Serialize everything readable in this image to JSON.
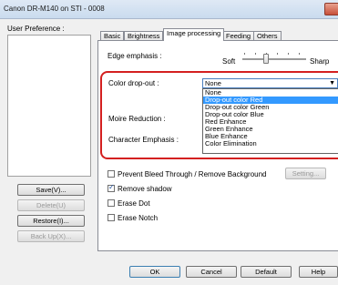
{
  "window": {
    "title": "Canon DR-M140 on STI - 0008"
  },
  "user_preference": {
    "label": "User Preference :",
    "buttons": {
      "save": "Save(V)...",
      "delete": "Delete(U)",
      "restore": "Restore(I)...",
      "backup": "Back Up(X)..."
    }
  },
  "tabs": [
    "Basic",
    "Brightness",
    "Image processing",
    "Feeding",
    "Others"
  ],
  "active_tab": "Image processing",
  "edge_emphasis": {
    "label": "Edge emphasis :",
    "min_label": "Soft",
    "max_label": "Sharp"
  },
  "color_dropout": {
    "label": "Color drop-out :",
    "selected": "None",
    "highlighted": "Drop-out color Red",
    "options": [
      "None",
      "Drop-out color Red",
      "Drop-out color Green",
      "Drop-out color Blue",
      "Red Enhance",
      "Green Enhance",
      "Blue Enhance",
      "Color Elimination"
    ]
  },
  "moire_reduction": {
    "label": "Moire Reduction :"
  },
  "character_emphasis": {
    "label": "Character Emphasis :"
  },
  "checkboxes": [
    {
      "label": "Prevent Bleed Through / Remove Background",
      "checked": false
    },
    {
      "label": "Remove shadow",
      "checked": true
    },
    {
      "label": "Erase Dot",
      "checked": false
    },
    {
      "label": "Erase Notch",
      "checked": false
    }
  ],
  "setting_button": "Setting...",
  "footer_buttons": {
    "ok": "OK",
    "cancel": "Cancel",
    "default": "Default",
    "help": "Help"
  }
}
